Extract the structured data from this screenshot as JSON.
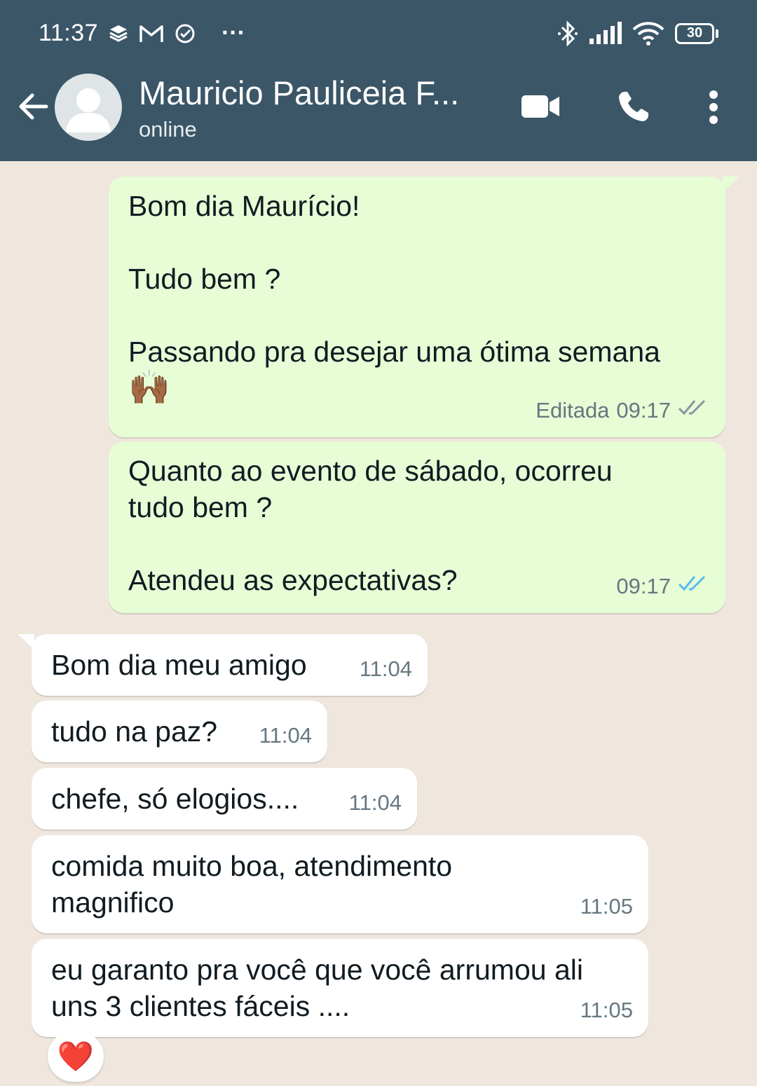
{
  "status_bar": {
    "time": "11:37",
    "more": "···",
    "battery": "30"
  },
  "header": {
    "contact_name": "Mauricio Pauliceia F...",
    "status": "online",
    "icons": [
      "back-arrow-icon",
      "avatar-icon",
      "video-call-icon",
      "phone-icon",
      "more-vertical-icon"
    ]
  },
  "messages": [
    {
      "direction": "out",
      "text": "Bom dia Maurício!\n\nTudo bem ?\n\nPassando pra desejar uma ótima semana",
      "emoji": "🙌🏾",
      "edited_label": "Editada",
      "time": "09:17",
      "ticks": "read-gray"
    },
    {
      "direction": "out",
      "text": "Quanto ao evento de sábado, ocorreu\ntudo bem ?\n\nAtendeu as expectativas?",
      "time": "09:17",
      "ticks": "read-blue"
    },
    {
      "direction": "in",
      "text": "Bom dia meu amigo",
      "time": "11:04"
    },
    {
      "direction": "in",
      "text": "tudo na paz?",
      "time": "11:04"
    },
    {
      "direction": "in",
      "text": "chefe, só elogios....",
      "time": "11:04"
    },
    {
      "direction": "in",
      "text": "comida muito boa, atendimento\nmagnifico",
      "time": "11:05"
    },
    {
      "direction": "in",
      "text": "eu garanto pra você que você arrumou ali\nuns 3 clientes fáceis ....",
      "time": "11:05",
      "reaction": "❤️"
    }
  ],
  "colors": {
    "header_bg": "#3b5667",
    "chat_bg": "#efe7de",
    "outgoing_bubble": "#e7fdd6",
    "incoming_bubble": "#ffffff",
    "read_tick_blue": "#53bdeb",
    "tick_gray": "#8696a0",
    "meta_text": "#667781"
  }
}
